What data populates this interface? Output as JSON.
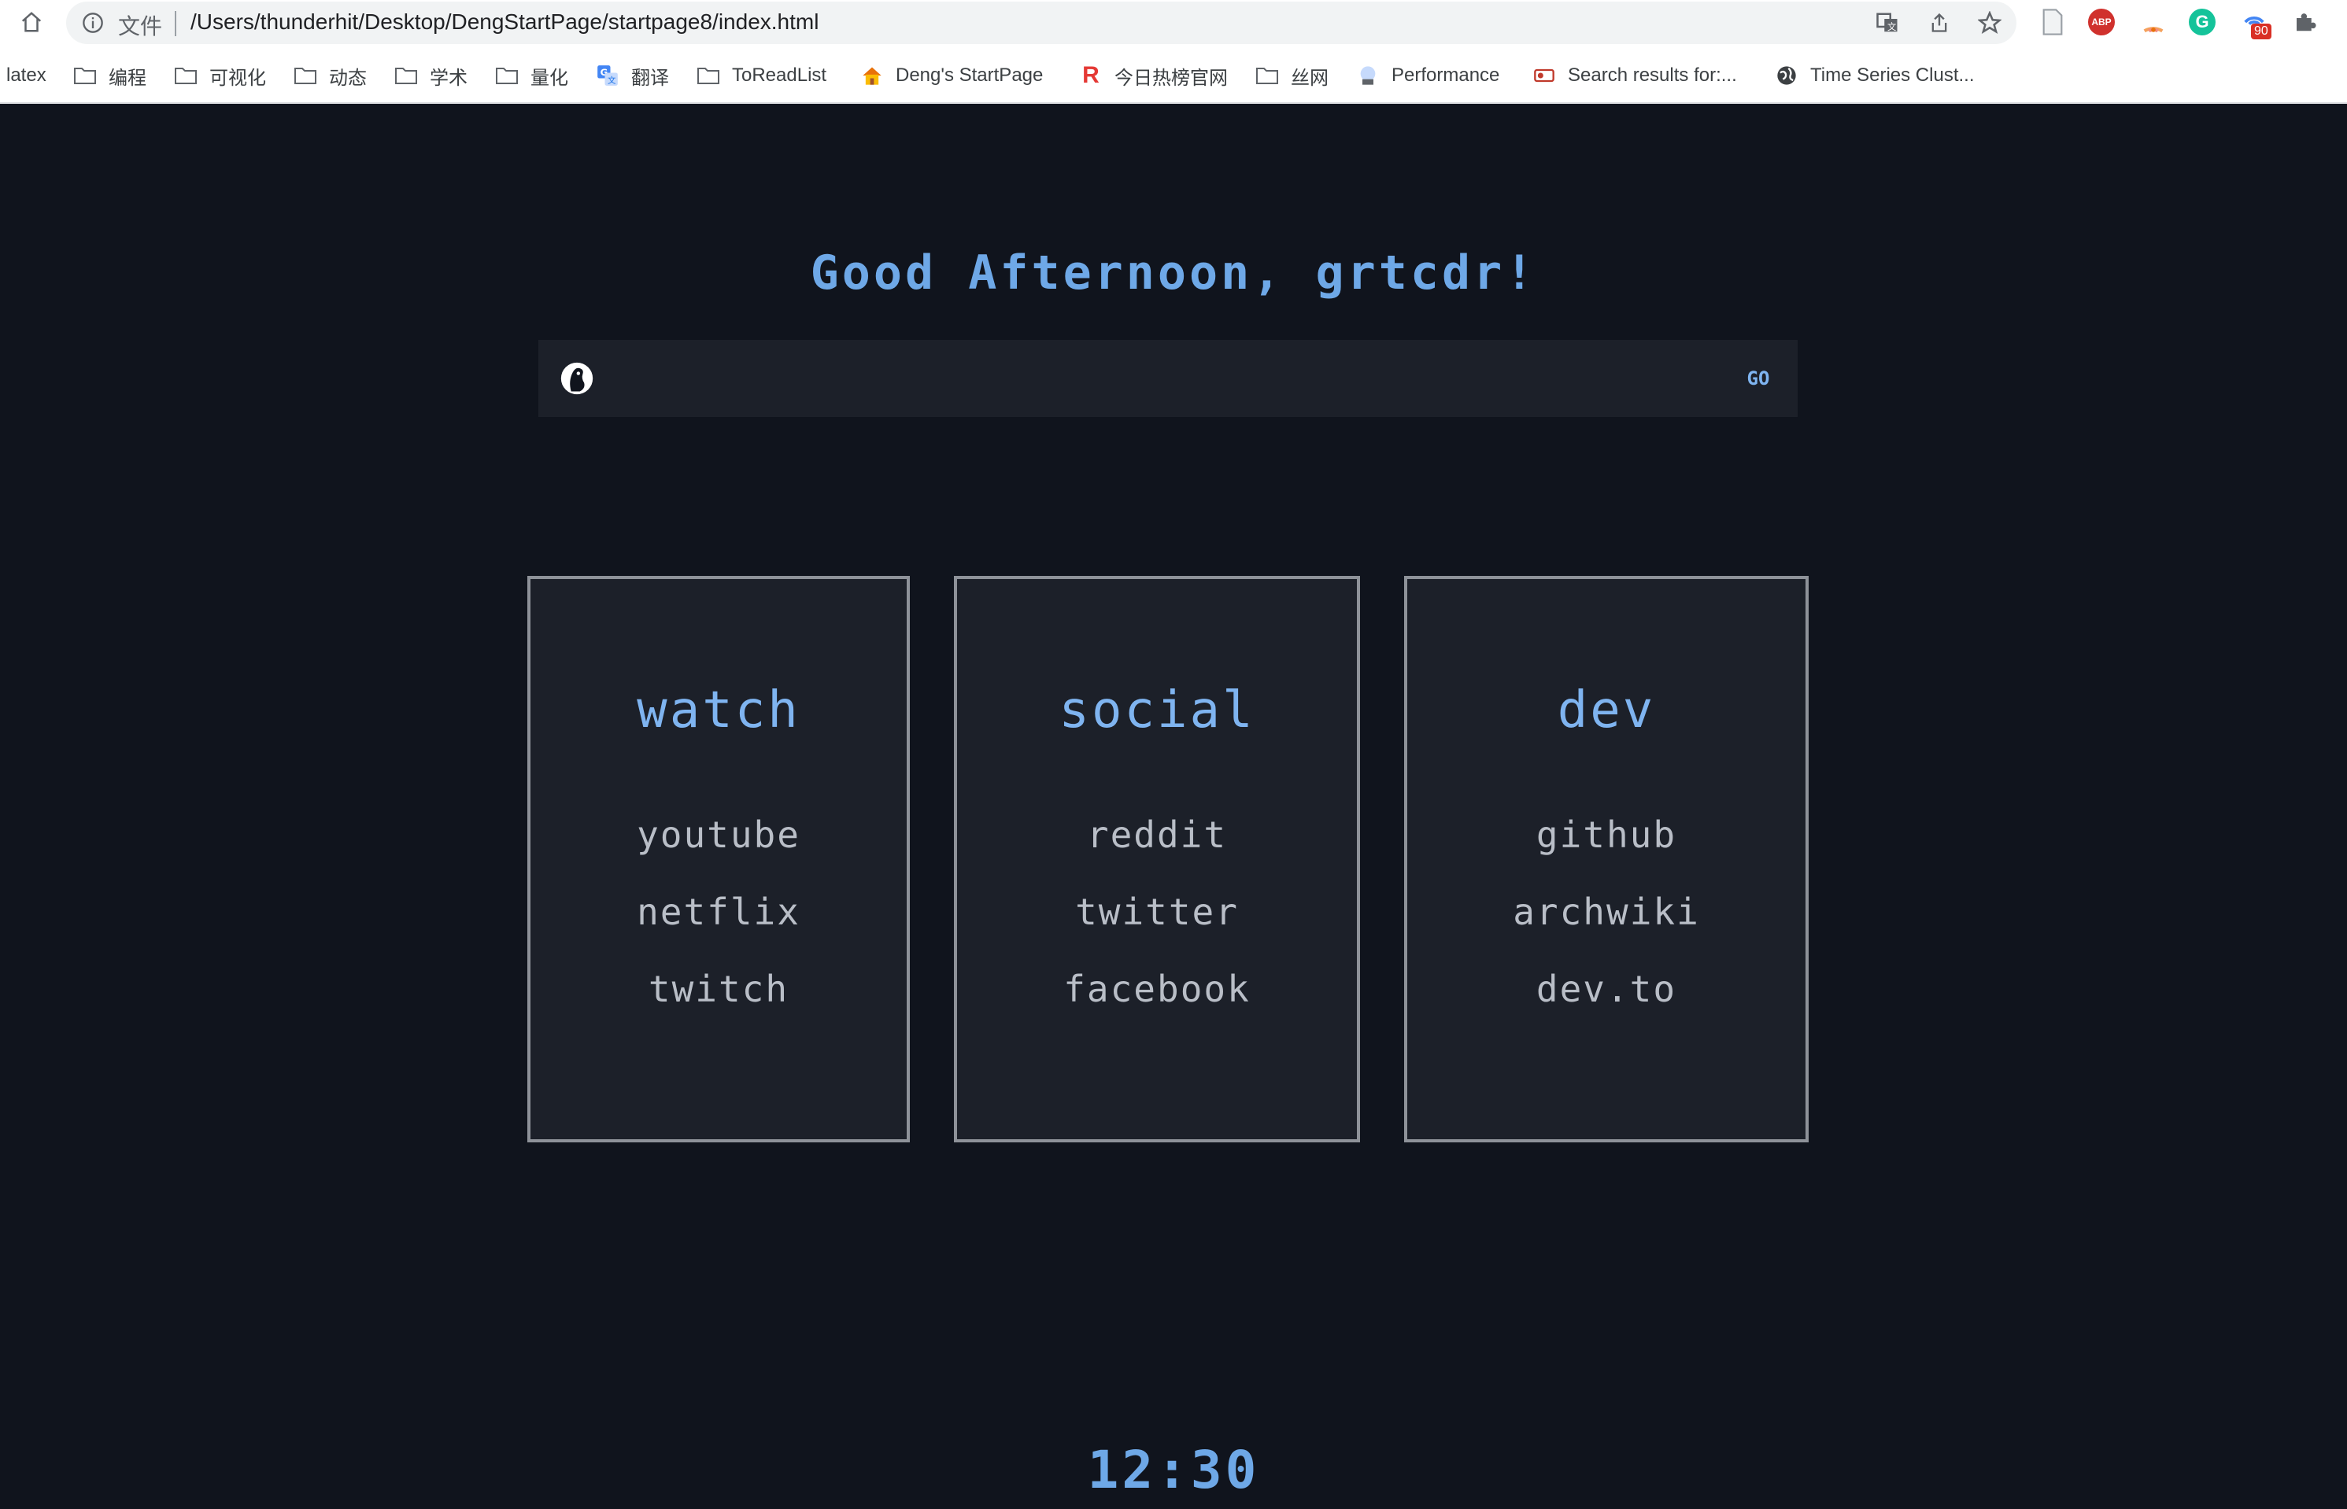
{
  "browser": {
    "url_label": "文件",
    "url": "/Users/thunderhit/Desktop/DengStartPage/startpage8/index.html",
    "extension_badge": "90",
    "abp_label": "ABP",
    "grammarly_label": "G",
    "bookmarks": [
      {
        "label": "latex",
        "icon": "none"
      },
      {
        "label": "编程",
        "icon": "folder-icon"
      },
      {
        "label": "可视化",
        "icon": "folder-icon"
      },
      {
        "label": "动态",
        "icon": "folder-icon"
      },
      {
        "label": "学术",
        "icon": "folder-icon"
      },
      {
        "label": "量化",
        "icon": "folder-icon"
      },
      {
        "label": "翻译",
        "icon": "translate-icon"
      },
      {
        "label": "ToReadList",
        "icon": "folder-icon"
      },
      {
        "label": "Deng's StartPage",
        "icon": "house-icon"
      },
      {
        "label": "今日热榜官网",
        "icon": "r-logo-icon"
      },
      {
        "label": "丝网",
        "icon": "folder-icon"
      },
      {
        "label": "Performance",
        "icon": "performance-icon"
      },
      {
        "label": "Search results for:...",
        "icon": "search-site-icon"
      },
      {
        "label": "Time Series Clust...",
        "icon": "globe-icon"
      }
    ]
  },
  "page": {
    "greeting": "Good Afternoon, grtcdr!",
    "search": {
      "placeholder": "",
      "go_label": "GO"
    },
    "cards": [
      {
        "title": "watch",
        "links": [
          "youtube",
          "netflix",
          "twitch"
        ]
      },
      {
        "title": "social",
        "links": [
          "reddit",
          "twitter",
          "facebook"
        ]
      },
      {
        "title": "dev",
        "links": [
          "github",
          "archwiki",
          "dev.to"
        ]
      }
    ],
    "clock": "12:30"
  },
  "colors": {
    "background": "#10141d",
    "card_background": "#1c2029",
    "accent": "#7fb4f0",
    "link_text": "#b9bec7"
  }
}
